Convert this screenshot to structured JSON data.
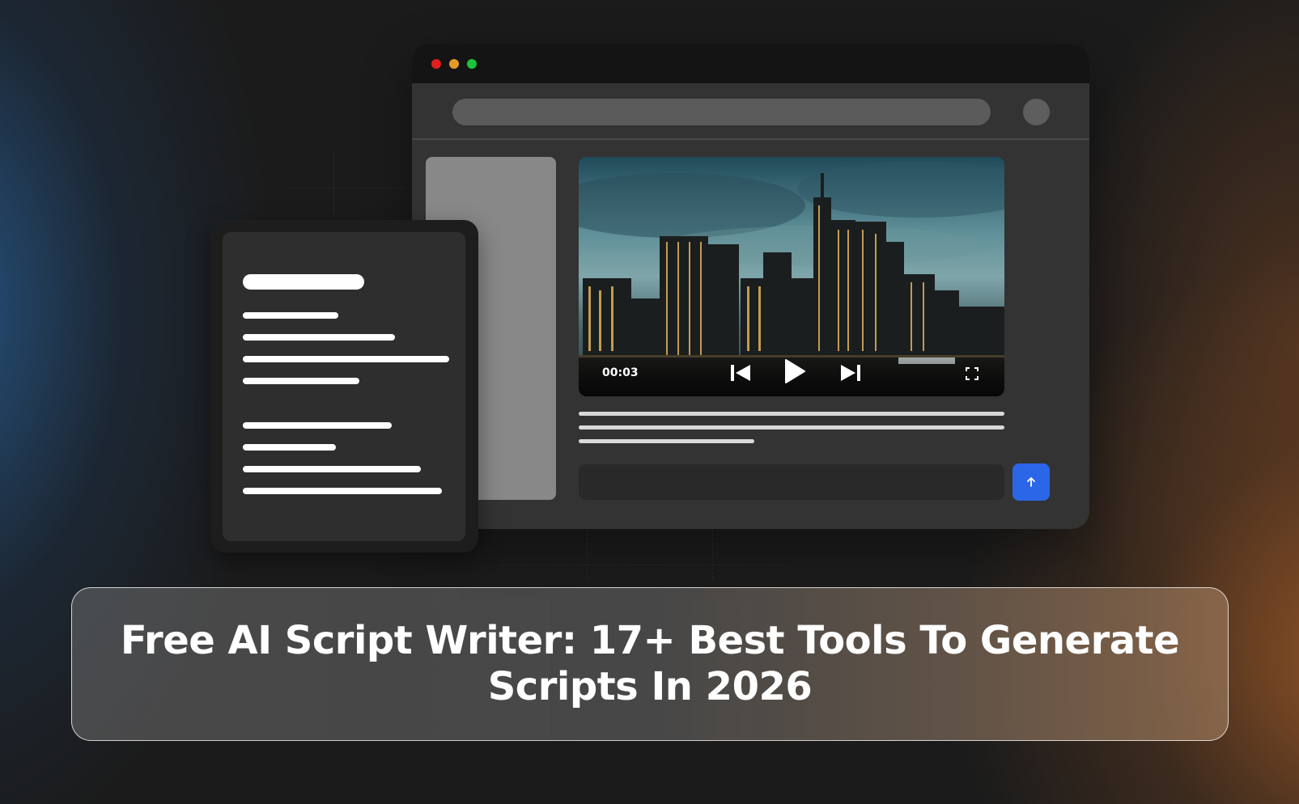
{
  "window": {
    "traffic_lights": {
      "close": "#e0201b",
      "minimize": "#e39a2a",
      "maximize": "#1fc33a"
    }
  },
  "video": {
    "timecode": "00:03",
    "controls": [
      "skip-back-icon",
      "play-icon",
      "skip-forward-icon",
      "fullscreen-icon"
    ]
  },
  "send_button": {
    "icon": "arrow-up-icon",
    "color": "#2b66e8"
  },
  "banner": {
    "title": "Free AI Script Writer: 17+ Best Tools To Generate Scripts In 2026"
  },
  "colors": {
    "accent_blue": "#2b66e8",
    "glow_left": "#285f96",
    "glow_right": "#aa5f28"
  }
}
